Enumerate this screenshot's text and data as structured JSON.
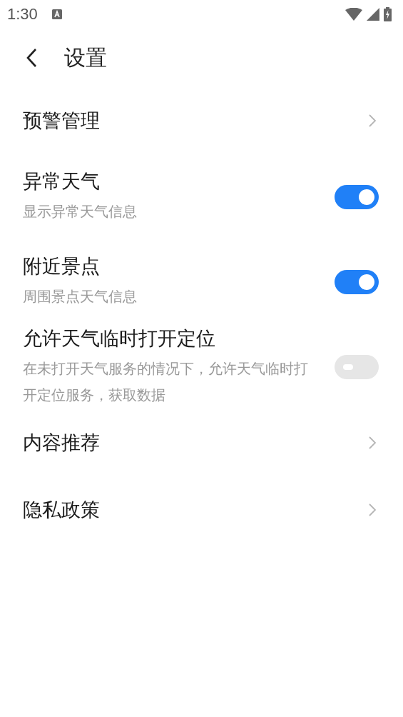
{
  "status_bar": {
    "time": "1:30"
  },
  "header": {
    "title": "设置"
  },
  "items": [
    {
      "kind": "link",
      "title": "预警管理"
    },
    {
      "kind": "switch",
      "title": "异常天气",
      "subtitle": "显示异常天气信息",
      "on": true
    },
    {
      "kind": "switch",
      "title": "附近景点",
      "subtitle": "周围景点天气信息",
      "on": true
    },
    {
      "kind": "switch",
      "title": "允许天气临时打开定位",
      "subtitle": "在未打开天气服务的情况下，允许天气临时打开定位服务，获取数据",
      "on": false
    },
    {
      "kind": "link",
      "title": "内容推荐"
    },
    {
      "kind": "link",
      "title": "隐私政策"
    }
  ]
}
